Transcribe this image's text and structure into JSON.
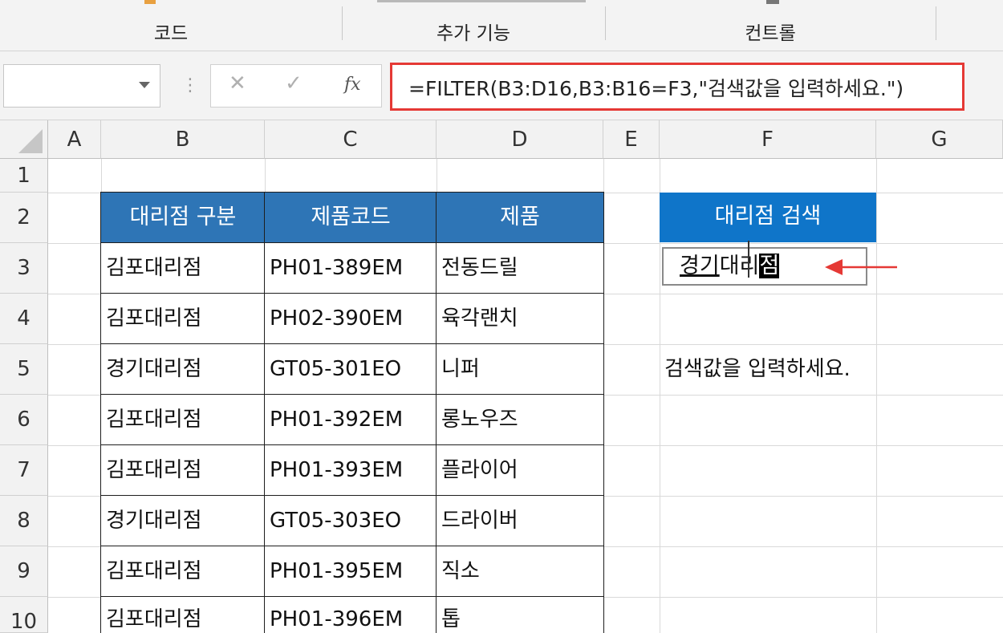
{
  "ribbon": {
    "groups": [
      {
        "label": "코드"
      },
      {
        "label": "추가 기능"
      },
      {
        "label": "컨트롤"
      }
    ]
  },
  "formula_bar": {
    "name_box": "",
    "cancel_glyph": "✕",
    "enter_glyph": "✓",
    "fx_label": "fx",
    "formula": "=FILTER(B3:D16,B3:B16=F3,\"검색값을 입력하세요.\")"
  },
  "columns": [
    "A",
    "B",
    "C",
    "D",
    "E",
    "F",
    "G"
  ],
  "rows": [
    "1",
    "2",
    "3",
    "4",
    "5",
    "6",
    "7",
    "8",
    "9",
    "10"
  ],
  "table": {
    "headers": [
      "대리점 구분",
      "제품코드",
      "제품"
    ],
    "rows": [
      [
        "김포대리점",
        "PH01-389EM",
        "전동드릴"
      ],
      [
        "김포대리점",
        "PH02-390EM",
        "육각랜치"
      ],
      [
        "경기대리점",
        "GT05-301EO",
        "니퍼"
      ],
      [
        "김포대리점",
        "PH01-392EM",
        "롱노우즈"
      ],
      [
        "김포대리점",
        "PH01-393EM",
        "플라이어"
      ],
      [
        "경기대리점",
        "GT05-303EO",
        "드라이버"
      ],
      [
        "김포대리점",
        "PH01-395EM",
        "직소"
      ],
      [
        "김포대리점",
        "PH01-396EM",
        "톱"
      ]
    ]
  },
  "search": {
    "header": "대리점 검색",
    "input_part1": "경기",
    "input_part2": "대리",
    "input_part3": "점",
    "result": "검색값을 입력하세요."
  },
  "colors": {
    "table_header": "#2e75b6",
    "search_header": "#0f75c9",
    "highlight_red": "#e53935"
  }
}
